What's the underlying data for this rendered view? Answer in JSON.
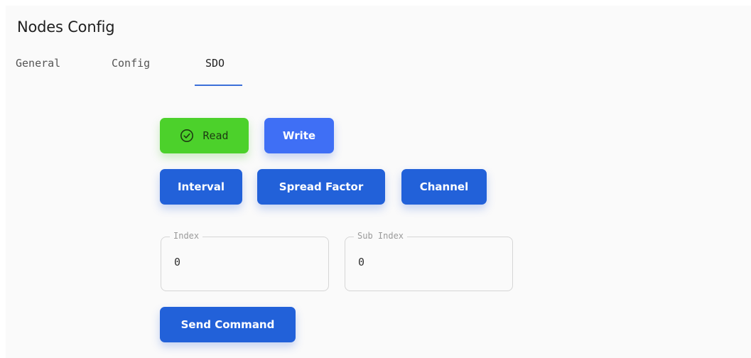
{
  "page": {
    "title": "Nodes Config"
  },
  "tabs": [
    {
      "label": "General",
      "active": false
    },
    {
      "label": "Config",
      "active": false
    },
    {
      "label": "SDO",
      "active": true
    }
  ],
  "mode": {
    "read_label": "Read",
    "write_label": "Write",
    "selected": "Read"
  },
  "presets": {
    "interval_label": "Interval",
    "spread_factor_label": "Spread Factor",
    "channel_label": "Channel"
  },
  "fields": {
    "index": {
      "label": "Index",
      "value": "0"
    },
    "sub_index": {
      "label": "Sub Index",
      "value": "0"
    }
  },
  "actions": {
    "send_label": "Send Command"
  },
  "colors": {
    "primary": "#2261d9",
    "write": "#3f6ff5",
    "read_selected": "#4cd12b",
    "tab_indicator": "#3b6fd8"
  },
  "icons": {
    "read_selected": "check-circle-icon"
  }
}
